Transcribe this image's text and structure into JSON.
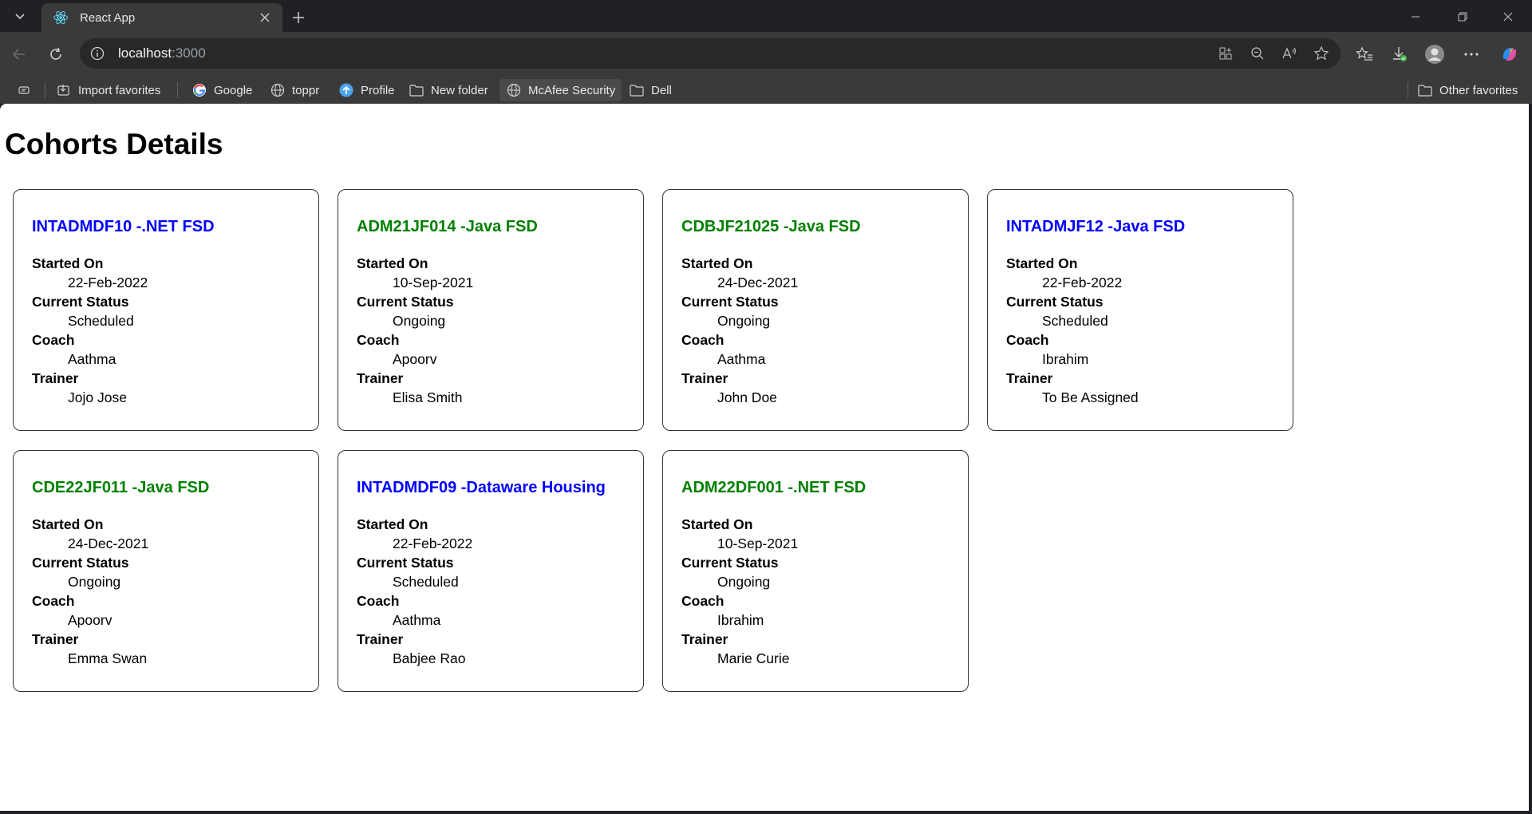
{
  "browser": {
    "tab_title": "React App",
    "url_host": "localhost",
    "url_port": ":3000"
  },
  "favorites": {
    "import": "Import favorites",
    "google": "Google",
    "toppr": "toppr",
    "profile": "Profile",
    "new_folder": "New folder",
    "mcafee": "McAfee Security",
    "dell": "Dell",
    "other": "Other favorites"
  },
  "page": {
    "title": "Cohorts Details",
    "labels": {
      "started_on": "Started On",
      "current_status": "Current Status",
      "coach": "Coach",
      "trainer": "Trainer"
    },
    "cohorts": [
      {
        "title": "INTADMDF10 -.NET FSD",
        "color": "#0000ff",
        "started_on": "22-Feb-2022",
        "status": "Scheduled",
        "coach": "Aathma",
        "trainer": "Jojo Jose"
      },
      {
        "title": "ADM21JF014 -Java FSD",
        "color": "#008000",
        "started_on": "10-Sep-2021",
        "status": "Ongoing",
        "coach": "Apoorv",
        "trainer": "Elisa Smith"
      },
      {
        "title": "CDBJF21025 -Java FSD",
        "color": "#008000",
        "started_on": "24-Dec-2021",
        "status": "Ongoing",
        "coach": "Aathma",
        "trainer": "John Doe"
      },
      {
        "title": "INTADMJF12 -Java FSD",
        "color": "#0000ff",
        "started_on": "22-Feb-2022",
        "status": "Scheduled",
        "coach": "Ibrahim",
        "trainer": "To Be Assigned"
      },
      {
        "title": "CDE22JF011 -Java FSD",
        "color": "#008000",
        "started_on": "24-Dec-2021",
        "status": "Ongoing",
        "coach": "Apoorv",
        "trainer": "Emma Swan"
      },
      {
        "title": "INTADMDF09 -Dataware Housing",
        "color": "#0000ff",
        "started_on": "22-Feb-2022",
        "status": "Scheduled",
        "coach": "Aathma",
        "trainer": "Babjee Rao"
      },
      {
        "title": "ADM22DF001 -.NET FSD",
        "color": "#008000",
        "started_on": "10-Sep-2021",
        "status": "Ongoing",
        "coach": "Ibrahim",
        "trainer": "Marie Curie"
      }
    ]
  }
}
